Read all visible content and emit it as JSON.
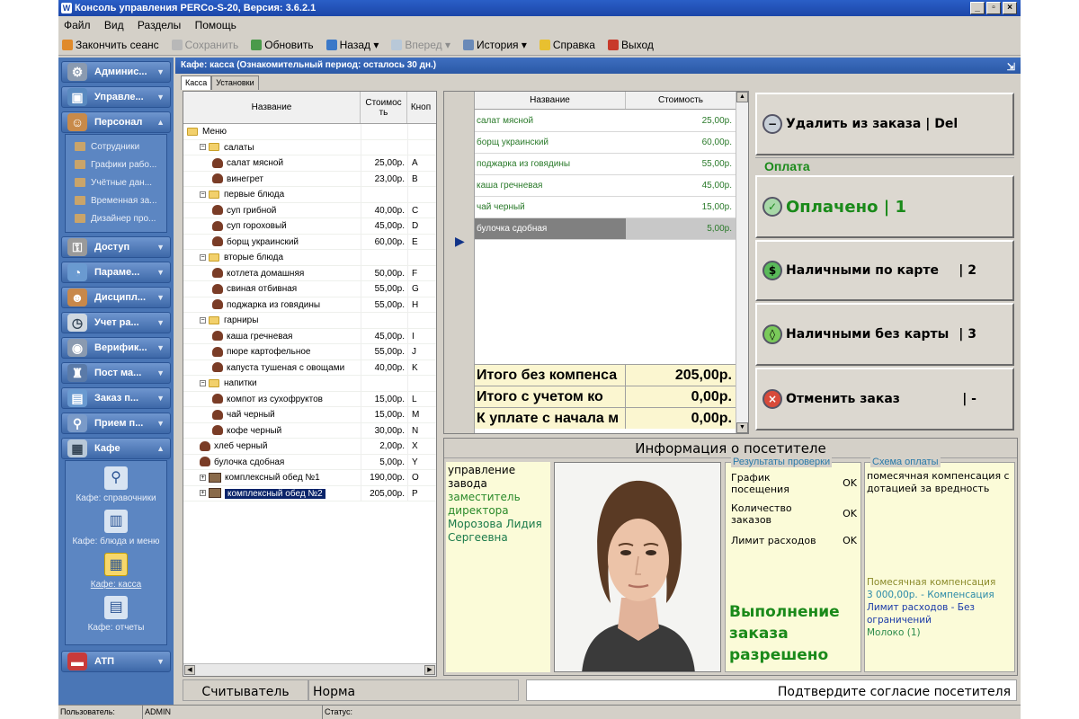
{
  "window": {
    "title": "Консоль управления PERCo-S-20, Версия: 3.6.2.1",
    "controls": [
      "_",
      "▫",
      "×"
    ]
  },
  "menu": [
    "Файл",
    "Вид",
    "Разделы",
    "Помощь"
  ],
  "toolbar": {
    "end_session": "Закончить сеанс",
    "save": "Сохранить",
    "refresh": "Обновить",
    "back": "Назад",
    "forward": "Вперед",
    "history": "История",
    "help": "Справка",
    "exit": "Выход"
  },
  "sidebar": {
    "items": [
      {
        "label": "Админис..."
      },
      {
        "label": "Управле..."
      },
      {
        "label": "Персонал"
      },
      {
        "label": "Доступ"
      },
      {
        "label": "Параме..."
      },
      {
        "label": "Дисципл..."
      },
      {
        "label": "Учет ра..."
      },
      {
        "label": "Верифик..."
      },
      {
        "label": "Пост ма..."
      },
      {
        "label": "Заказ п..."
      },
      {
        "label": "Прием п..."
      },
      {
        "label": "Кафе"
      },
      {
        "label": "АТП"
      }
    ],
    "personnel_sub": [
      "Сотрудники",
      "Графики рабо...",
      "Учётные дан...",
      "Временная за...",
      "Дизайнер про..."
    ],
    "cafe_sub": [
      "Кафе: справочники",
      "Кафе: блюда и меню",
      "Кафе: касса",
      "Кафе: отчеты"
    ]
  },
  "header": {
    "title": "Кафе: касса (Ознакомительный период: осталось 30 дн.)"
  },
  "tabs": [
    "Касса",
    "Установки"
  ],
  "menu_tree": {
    "headers": [
      "Название",
      "Стоимос ть",
      "Кноп"
    ],
    "rows": [
      {
        "name": "Меню",
        "price": "",
        "key": "",
        "level": 0,
        "type": "folder"
      },
      {
        "name": "салаты",
        "price": "",
        "key": "",
        "level": 1,
        "type": "folder"
      },
      {
        "name": "салат мясной",
        "price": "25,00р.",
        "key": "A",
        "level": 2,
        "type": "dish"
      },
      {
        "name": "винегрет",
        "price": "23,00р.",
        "key": "B",
        "level": 2,
        "type": "dish"
      },
      {
        "name": "первые блюда",
        "price": "",
        "key": "",
        "level": 1,
        "type": "folder"
      },
      {
        "name": "суп грибной",
        "price": "40,00р.",
        "key": "C",
        "level": 2,
        "type": "dish"
      },
      {
        "name": "суп гороховый",
        "price": "45,00р.",
        "key": "D",
        "level": 2,
        "type": "dish"
      },
      {
        "name": "борщ украинский",
        "price": "60,00р.",
        "key": "E",
        "level": 2,
        "type": "dish"
      },
      {
        "name": "вторые блюда",
        "price": "",
        "key": "",
        "level": 1,
        "type": "folder"
      },
      {
        "name": "котлета домашняя",
        "price": "50,00р.",
        "key": "F",
        "level": 2,
        "type": "dish"
      },
      {
        "name": "свиная отбивная",
        "price": "55,00р.",
        "key": "G",
        "level": 2,
        "type": "dish"
      },
      {
        "name": "поджарка из говядины",
        "price": "55,00р.",
        "key": "H",
        "level": 2,
        "type": "dish"
      },
      {
        "name": "гарниры",
        "price": "",
        "key": "",
        "level": 1,
        "type": "folder"
      },
      {
        "name": "каша гречневая",
        "price": "45,00р.",
        "key": "I",
        "level": 2,
        "type": "dish"
      },
      {
        "name": "пюре картофельное",
        "price": "55,00р.",
        "key": "J",
        "level": 2,
        "type": "dish"
      },
      {
        "name": "капуста тушеная с овощами",
        "price": "40,00р.",
        "key": "K",
        "level": 2,
        "type": "dish"
      },
      {
        "name": "напитки",
        "price": "",
        "key": "",
        "level": 1,
        "type": "folder"
      },
      {
        "name": "компот из сухофруктов",
        "price": "15,00р.",
        "key": "L",
        "level": 2,
        "type": "dish"
      },
      {
        "name": "чай черный",
        "price": "15,00р.",
        "key": "M",
        "level": 2,
        "type": "dish"
      },
      {
        "name": "кофе черный",
        "price": "30,00р.",
        "key": "N",
        "level": 2,
        "type": "dish"
      },
      {
        "name": "хлеб черный",
        "price": "2,00р.",
        "key": "X",
        "level": 1,
        "type": "dish"
      },
      {
        "name": "булочка сдобная",
        "price": "5,00р.",
        "key": "Y",
        "level": 1,
        "type": "dish"
      },
      {
        "name": "комплексный обед №1",
        "price": "190,00р.",
        "key": "O",
        "level": 1,
        "type": "combo"
      },
      {
        "name": "комплексный обед №2",
        "price": "205,00р.",
        "key": "P",
        "level": 1,
        "type": "combo",
        "selected": true
      }
    ]
  },
  "order": {
    "headers": [
      "Название",
      "Стоимость"
    ],
    "rows": [
      {
        "name": "салат мясной",
        "price": "25,00р."
      },
      {
        "name": "борщ украинский",
        "price": "60,00р."
      },
      {
        "name": "поджарка из говядины",
        "price": "55,00р."
      },
      {
        "name": "каша гречневая",
        "price": "45,00р."
      },
      {
        "name": "чай черный",
        "price": "15,00р."
      },
      {
        "name": "булочка сдобная",
        "price": "5,00р.",
        "selected": true
      }
    ],
    "totals": [
      {
        "label": "Итого без компенса",
        "value": "205,00р."
      },
      {
        "label": "Итого с учетом ко",
        "value": "0,00р."
      },
      {
        "label": "К уплате с начала м",
        "value": "0,00р."
      }
    ]
  },
  "actions": {
    "remove": {
      "label": "Удалить из заказа | Del"
    },
    "payment_group": "Оплата",
    "paid": {
      "label": "Оплачено | 1"
    },
    "cash_card": {
      "label": "Наличными по карте",
      "hotkey": "| 2"
    },
    "cash_nocard": {
      "label": "Наличными без карты",
      "hotkey": "| 3"
    },
    "cancel": {
      "label": "Отменить заказ",
      "hotkey": "| -"
    }
  },
  "visitor": {
    "title": "Информация о посетителе",
    "department": "управление завода",
    "position": "заместитель директора",
    "name": "Морозова Лидия Сергеевна",
    "checks_title": "Результаты проверки",
    "checks": [
      {
        "label": "График посещения",
        "value": "OK"
      },
      {
        "label": "Количество заказов",
        "value": "OK"
      },
      {
        "label": "Лимит расходов",
        "value": "OK"
      }
    ],
    "result": "Выполнение заказа разрешено",
    "scheme_title": "Схема оплаты",
    "scheme": "помесячная компенсация с дотацией за вредность",
    "scheme_details": [
      "Помесячная компенсация",
      "3 000,00р. - Компенсация",
      "Лимит расходов - Без ограничений",
      "Молоко (1)"
    ]
  },
  "status": {
    "reader_label": "Считыватель",
    "reader_value": "Норма",
    "message": "Подтвердите согласие посетителя"
  },
  "bottombar": {
    "user_label": "Пользователь:",
    "user": "ADMIN",
    "status_label": "Статус:"
  },
  "colors": {
    "title_bar": "#1c46a8",
    "sidebar": "#4a76b6",
    "accent_green": "#1a8a1a",
    "total_bg": "#fbf6d0",
    "visitor_bg": "#fbfbd8"
  }
}
